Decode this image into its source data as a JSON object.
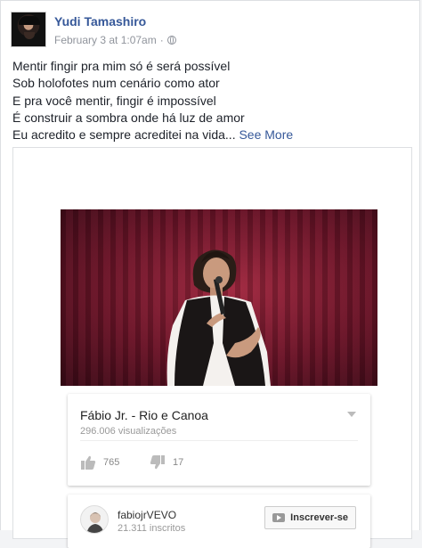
{
  "post": {
    "author": "Yudi Tamashiro",
    "timestamp": "February 3 at 1:07am",
    "separator": "·",
    "privacy_icon": "globe-icon",
    "text_lines": [
      "Mentir fingir pra mim só é será possível",
      "Sob holofotes num cenário como ator",
      "E pra você mentir, fingir é impossível",
      "É construir a sombra onde há luz de amor",
      "Eu acredito e sempre acreditei na vida..."
    ],
    "see_more": " See More"
  },
  "video": {
    "title": "Fábio Jr. - Rio e Canoa",
    "views": "296.006 visualizações",
    "likes": "765",
    "dislikes": "17"
  },
  "channel": {
    "name": "fabiojrVEVO",
    "subscribers": "21.311 inscritos",
    "subscribe_label": "Inscrever-se"
  }
}
